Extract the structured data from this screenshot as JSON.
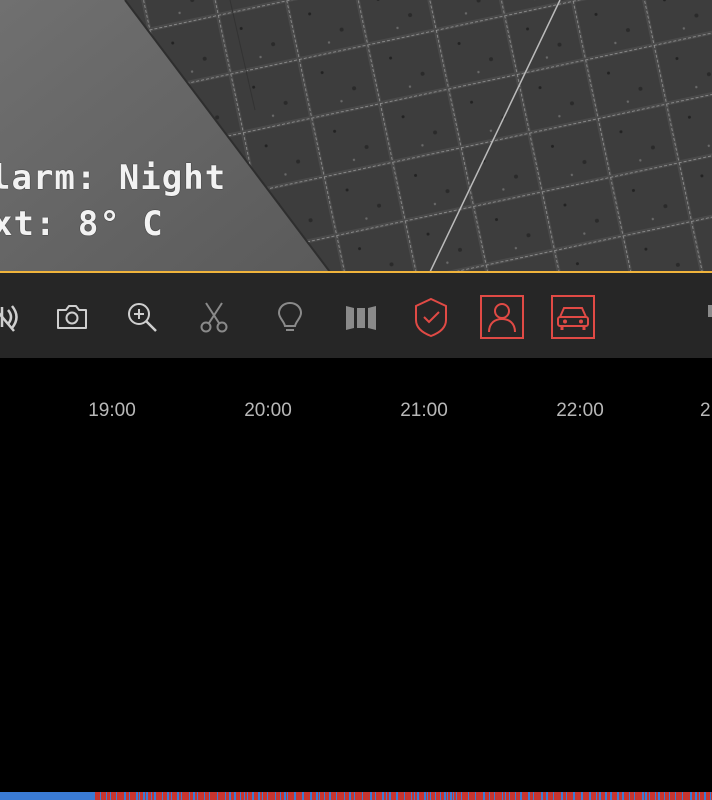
{
  "osd": {
    "alarm_text": "larm: Night",
    "ext_text": "xt: 8° C"
  },
  "colors": {
    "accent": "#f0b43c",
    "toolbar_bg": "#262626",
    "icon_gray": "#8a8a8a",
    "icon_light": "#cfcfcf",
    "alert_red": "#e04a45",
    "rec_red": "#c8352f",
    "rec_blue": "#3a7bd5"
  },
  "toolbar": {
    "icons": [
      "audio-icon",
      "snapshot-icon",
      "zoom-in-icon",
      "clip-icon",
      "light-icon",
      "columns-icon",
      "shield-check-icon",
      "person-detection-icon",
      "vehicle-detection-icon"
    ]
  },
  "timeline": {
    "ticks": [
      {
        "label": "19:00"
      },
      {
        "label": "20:00"
      },
      {
        "label": "21:00"
      },
      {
        "label": "22:00"
      }
    ]
  }
}
